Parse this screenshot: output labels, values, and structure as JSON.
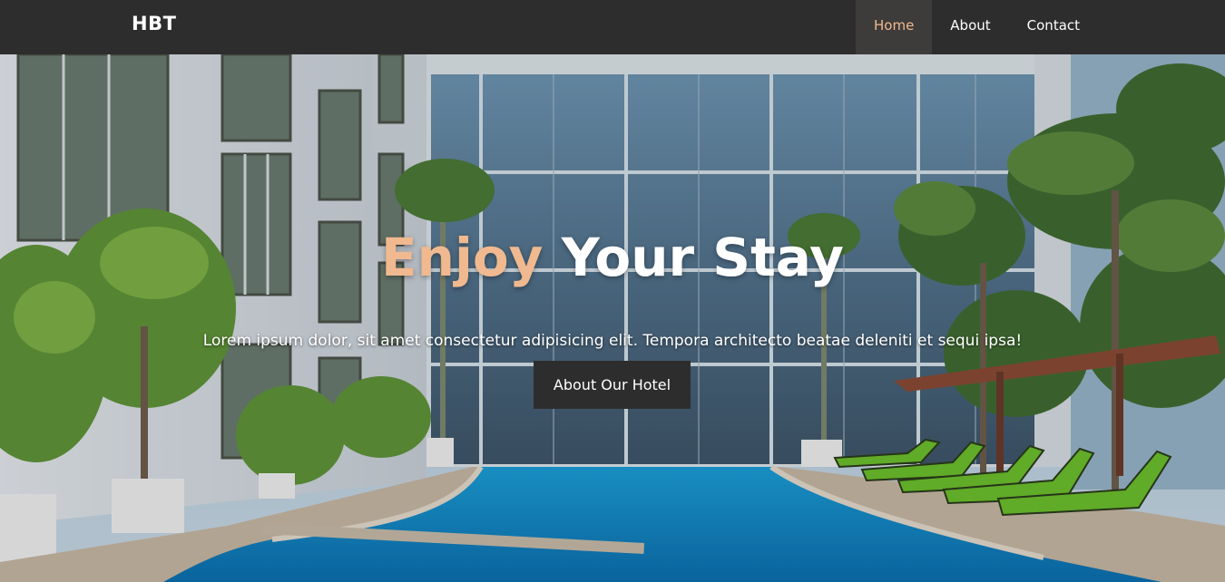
{
  "navbar": {
    "brand": "HBT",
    "links": [
      {
        "label": "Home",
        "active": true
      },
      {
        "label": "About",
        "active": false
      },
      {
        "label": "Contact",
        "active": false
      }
    ]
  },
  "hero": {
    "headline_accent": "Enjoy",
    "headline_rest": "Your Stay",
    "subtext": "Lorem ipsum dolor, sit amet consectetur adipisicing elit. Tempora architecto beatae deleniti et sequi ipsa!",
    "cta_label": "About Our Hotel"
  },
  "colors": {
    "navbar_bg": "#2e2d2d",
    "accent": "#f0b98f",
    "active_link_bg": "#3e3c3b",
    "button_bg": "#2e2d2d"
  }
}
